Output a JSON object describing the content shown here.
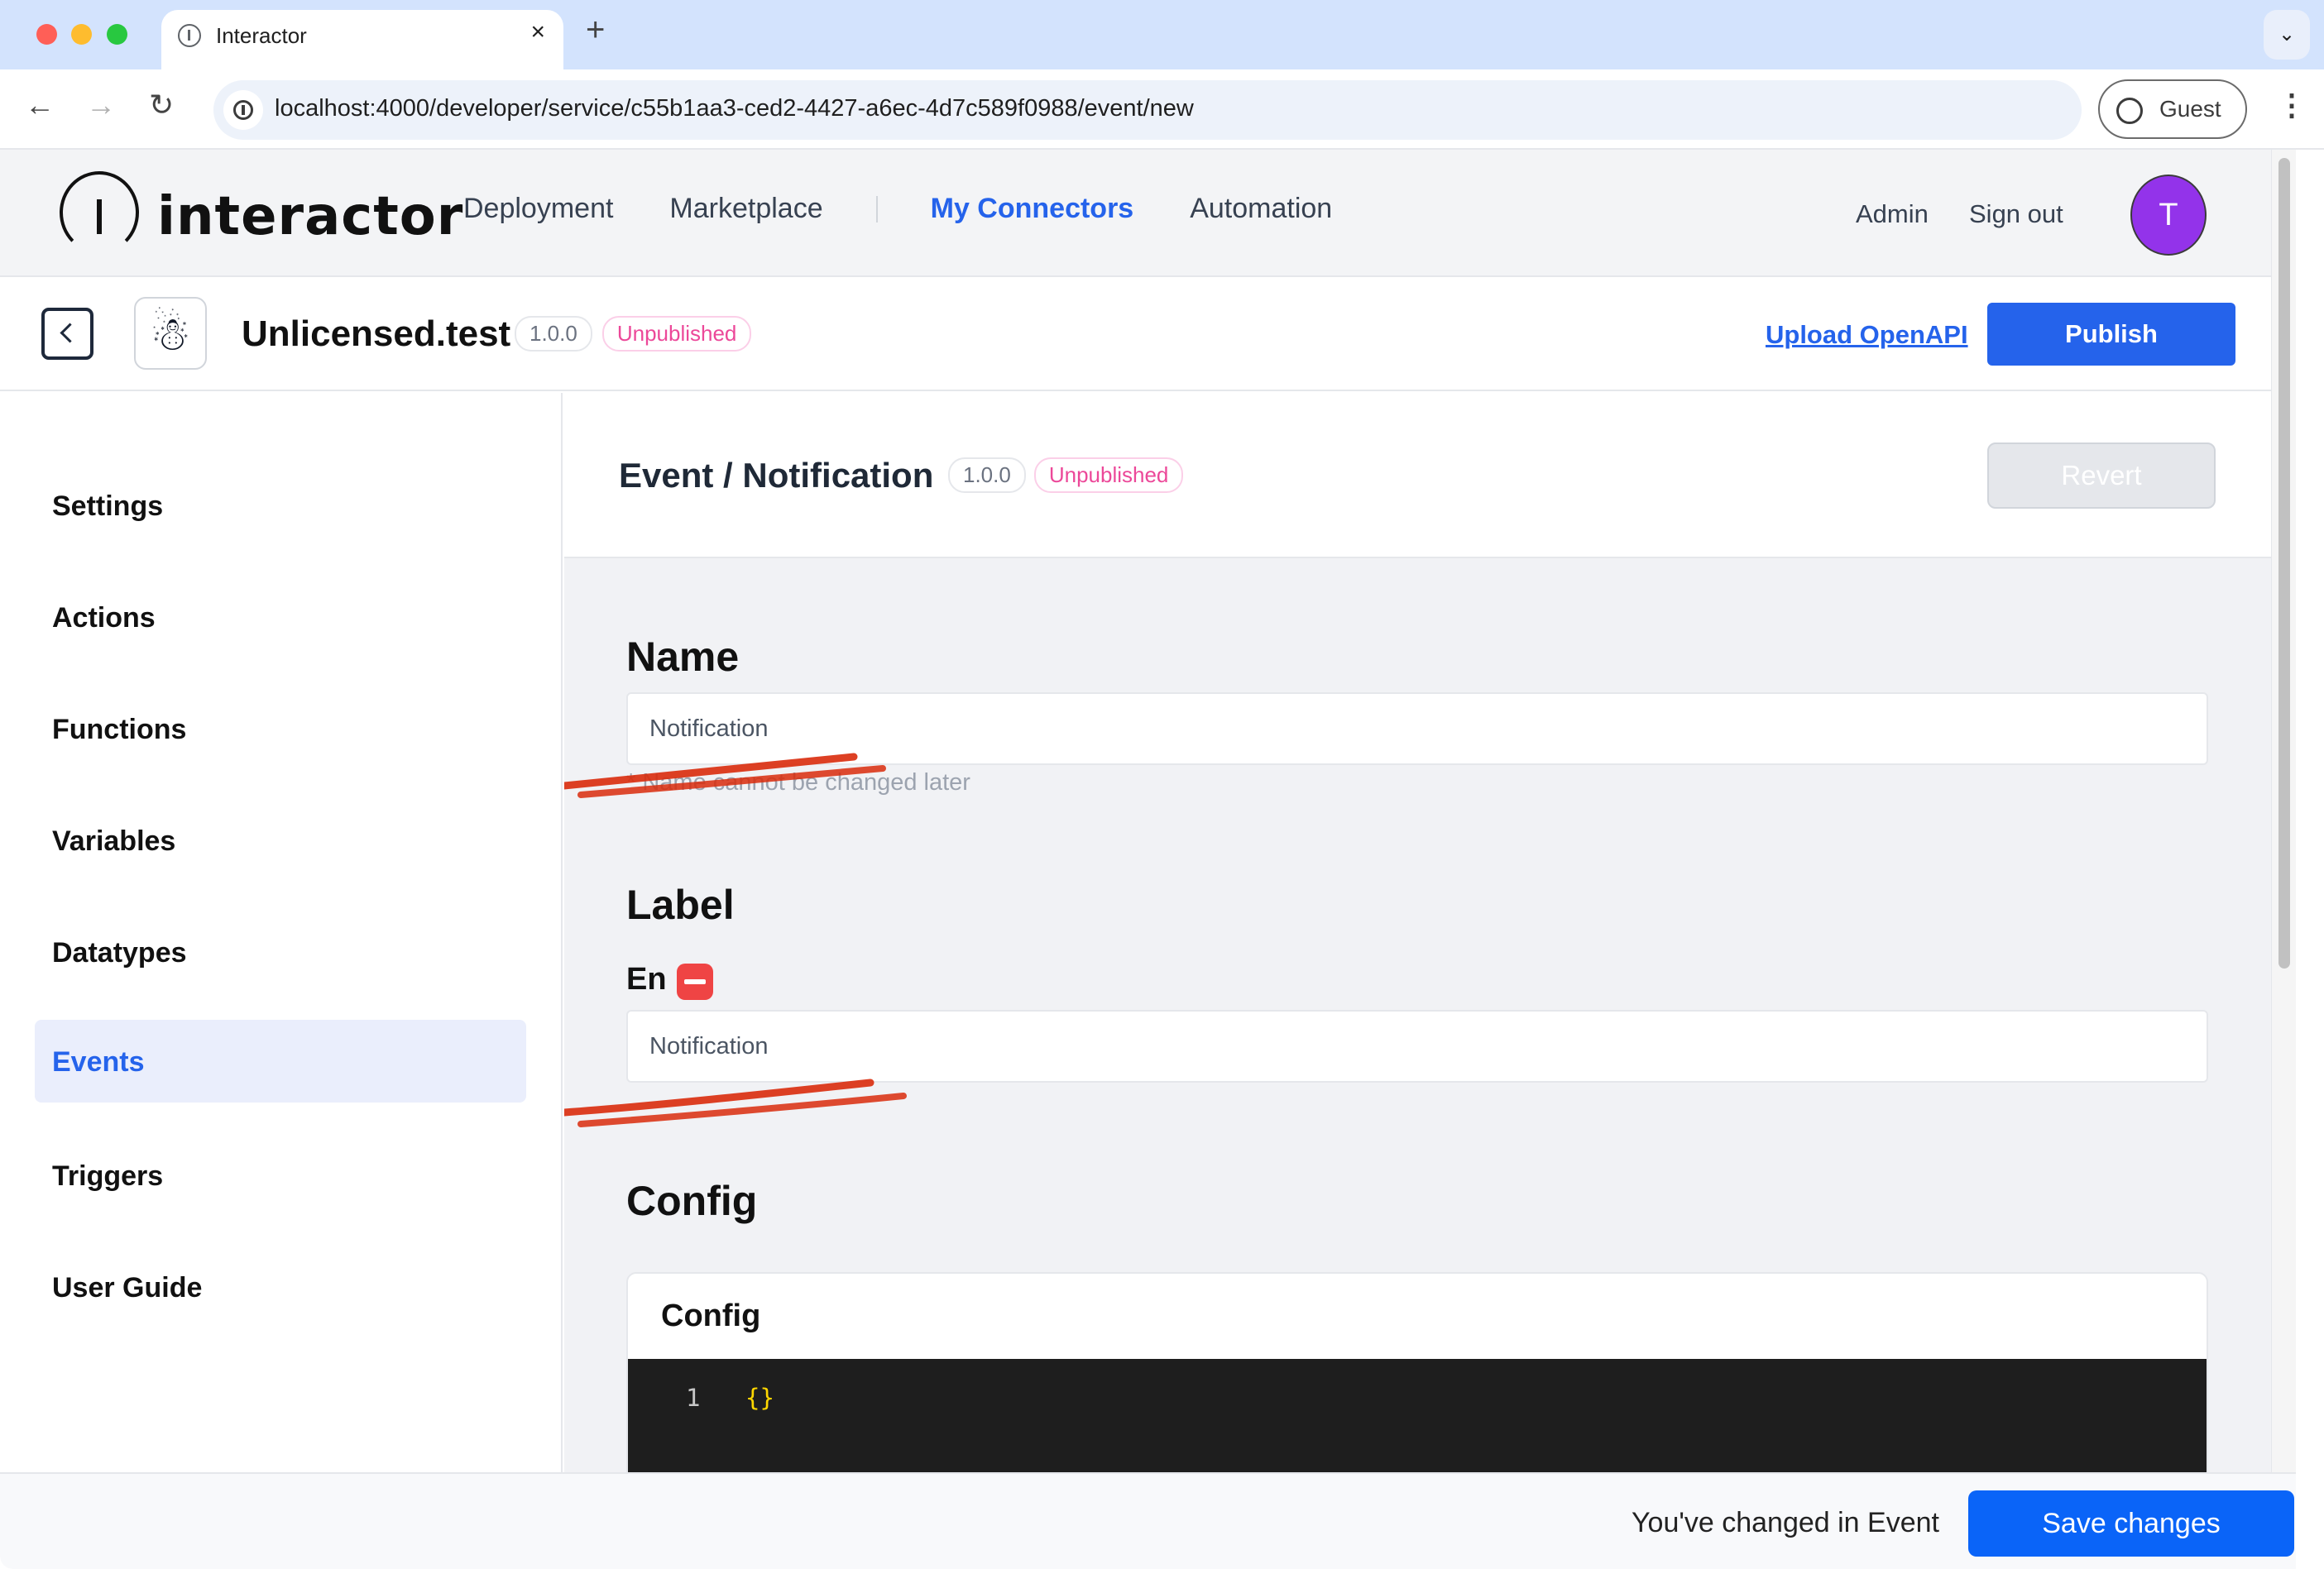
{
  "browser": {
    "tab_title": "Interactor",
    "tab_close": "×",
    "new_tab": "+",
    "tab_search": "⌄",
    "url": "localhost:4000/developer/service/c55b1aa3-ced2-4427-a6ec-4d7c589f0988/event/new",
    "profile_label": "Guest",
    "nav": {
      "back": "←",
      "forward": "→",
      "reload": "↻",
      "menu": "⋮"
    }
  },
  "header": {
    "logo_text": "interactor",
    "nav": [
      {
        "label": "Deployment",
        "active": false
      },
      {
        "label": "Marketplace",
        "active": false
      },
      {
        "label": "My Connectors",
        "active": true
      },
      {
        "label": "Automation",
        "active": false
      }
    ],
    "admin_label": "Admin",
    "signout_label": "Sign out",
    "avatar_initial": "T",
    "avatar_color": "#9333ea"
  },
  "connector": {
    "icon": "☃",
    "name": "Unlicensed.test",
    "version": "1.0.0",
    "status": "Unpublished",
    "upload_label": "Upload OpenAPI",
    "publish_label": "Publish"
  },
  "sidebar": {
    "items": [
      {
        "label": "Settings",
        "active": false
      },
      {
        "label": "Actions",
        "active": false
      },
      {
        "label": "Functions",
        "active": false
      },
      {
        "label": "Variables",
        "active": false
      },
      {
        "label": "Datatypes",
        "active": false
      },
      {
        "label": "Events",
        "active": true
      },
      {
        "label": "Triggers",
        "active": false
      },
      {
        "label": "User Guide",
        "active": false
      }
    ]
  },
  "event": {
    "breadcrumb_parent": "Event",
    "breadcrumb_sep": "/",
    "breadcrumb_current": "Notification",
    "version": "1.0.0",
    "status": "Unpublished",
    "revert_label": "Revert",
    "name_section": "Name",
    "name_value": "Notification",
    "name_hint": "* Name cannot be changed later",
    "label_section": "Label",
    "label_lang": "En",
    "label_value": "Notification",
    "config_section": "Config",
    "config_card_title": "Config",
    "code_lines": [
      {
        "no": "1",
        "text": "{}"
      }
    ]
  },
  "footer": {
    "message": "You've changed in Event",
    "save_label": "Save changes"
  },
  "colors": {
    "primary": "#2563eb",
    "save": "#0a64f8",
    "unpublished": "#ec4899",
    "danger": "#ef4444",
    "annotation": "#d92b0c"
  }
}
